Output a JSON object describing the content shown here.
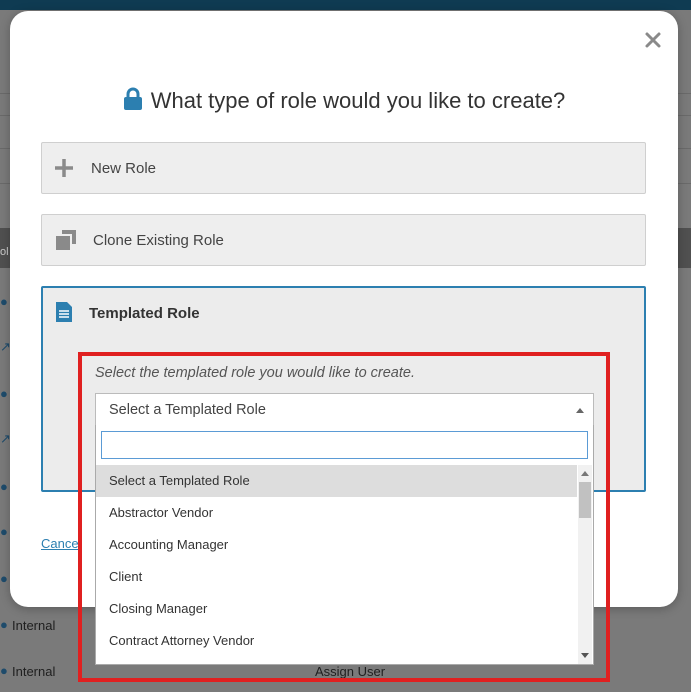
{
  "modal": {
    "title": "What type of role would you like to create?",
    "options": [
      {
        "label": "New Role",
        "icon": "plus-icon"
      },
      {
        "label": "Clone Existing Role",
        "icon": "clone-icon"
      },
      {
        "label": "Templated Role",
        "icon": "document-icon"
      }
    ],
    "cancel_label": "Cancel",
    "close_icon": "close-icon"
  },
  "templated": {
    "instruction": "Select the templated role you would like to create.",
    "selected_value": "Select a Templated Role",
    "search_value": "",
    "options": [
      "Select a Templated Role",
      "Abstractor Vendor",
      "Accounting Manager",
      "Client",
      "Closing Manager",
      "Contract Attorney Vendor"
    ]
  },
  "background": {
    "partial_label": "ol",
    "rows": [
      {
        "text": "Internal"
      },
      {
        "text": "Internal",
        "action": "Assign User"
      }
    ]
  },
  "colors": {
    "accent": "#2c7fb0",
    "highlight": "#e02020",
    "lock": "#2c7fb0"
  }
}
